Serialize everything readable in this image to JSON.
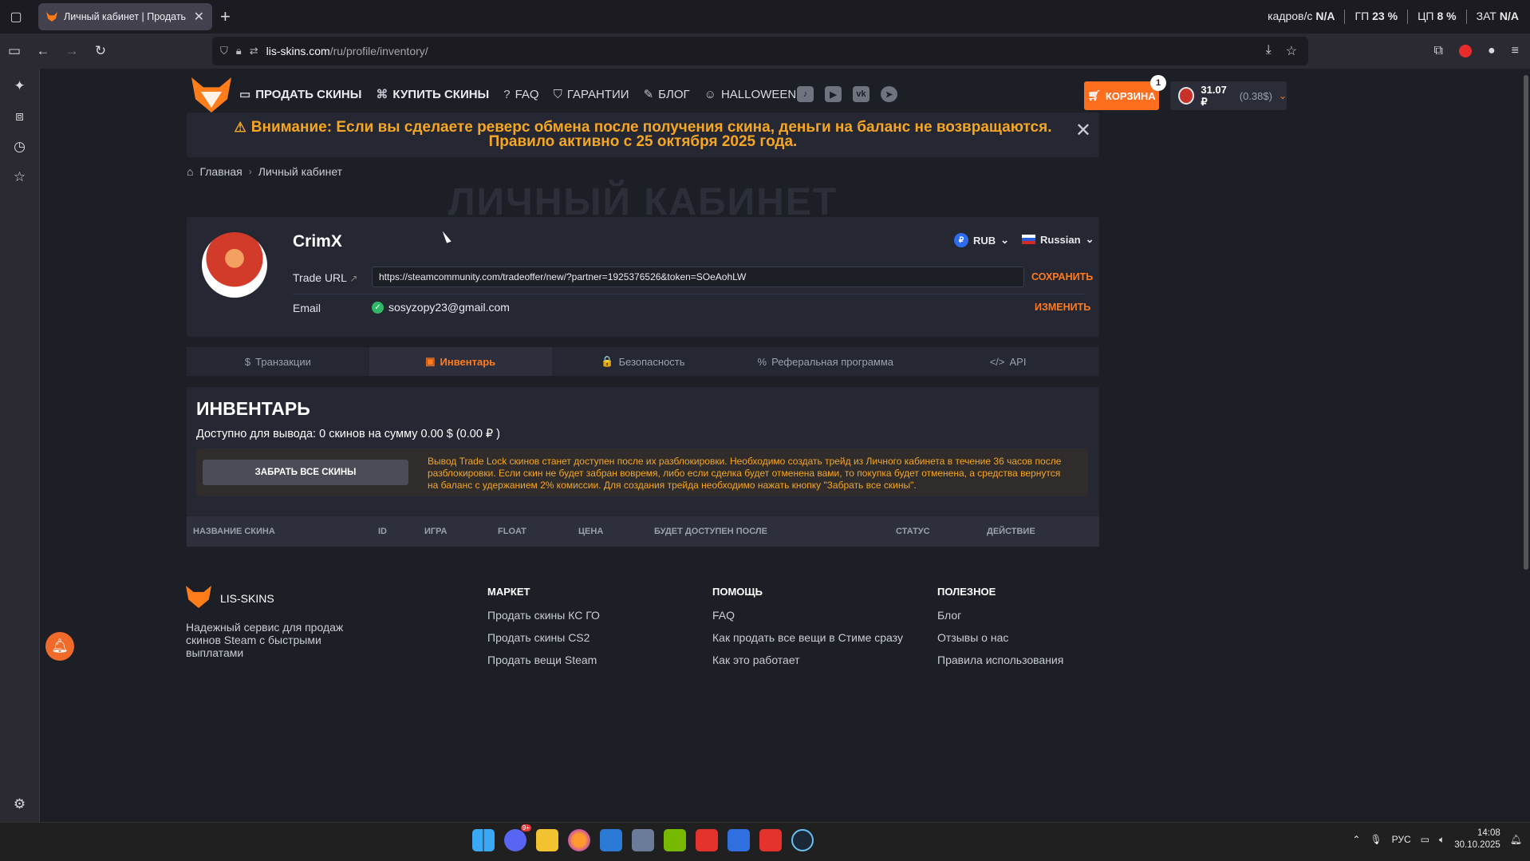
{
  "browser": {
    "tab_title": "Личный кабинет | Продать ск",
    "url_host": "lis-skins.com",
    "url_path": "/ru/profile/inventory/",
    "sysmon": [
      {
        "label": "кадров/с",
        "value": "N/A"
      },
      {
        "label": "ГП",
        "value": "23 %"
      },
      {
        "label": "ЦП",
        "value": "8 %"
      },
      {
        "label": "ЗАТ",
        "value": "N/A"
      }
    ]
  },
  "header": {
    "menu": [
      {
        "icon": "sell-icon",
        "label": "ПРОДАТЬ СКИНЫ"
      },
      {
        "icon": "buy-icon",
        "label": "КУПИТЬ СКИНЫ"
      },
      {
        "icon": "help-icon",
        "label": "FAQ"
      },
      {
        "icon": "shield-icon",
        "label": "ГАРАНТИИ"
      },
      {
        "icon": "edit-icon",
        "label": "БЛОГ"
      },
      {
        "icon": "pumpkin-icon",
        "label": "HALLOWEEN"
      }
    ],
    "socials": [
      "tiktok-icon",
      "youtube-icon",
      "vk-icon",
      "telegram-icon"
    ],
    "cart_label": "КОРЗИНА",
    "cart_count": "1",
    "balance_rub": "31.07 ₽",
    "balance_usd": "(0.38$)"
  },
  "banner": {
    "line1": "Внимание: Если вы сделаете реверс обмена после получения скина, деньги на баланс не возвращаются.",
    "line2": "Правило активно с 25 октября 2025 года."
  },
  "breadcrumb": {
    "home": "Главная",
    "current": "Личный кабинет"
  },
  "page_title": "ЛИЧНЫЙ КАБИНЕТ",
  "profile": {
    "username": "CrimX",
    "currency": "RUB",
    "currency_symbol": "₽",
    "language": "Russian",
    "trade_url_label": "Trade URL",
    "trade_url_value": "https://steamcommunity.com/tradeoffer/new/?partner=1925376526&token=SOeAohLW",
    "save_label": "СОХРАНИТЬ",
    "email_label": "Email",
    "email_value": "sosyzopy23@gmail.com",
    "change_label": "ИЗМЕНИТЬ"
  },
  "tabs": [
    {
      "icon": "$",
      "label": "Транзакции"
    },
    {
      "icon": "▣",
      "label": "Инвентарь"
    },
    {
      "icon": "🔒",
      "label": "Безопасность"
    },
    {
      "icon": "%",
      "label": "Реферальная программа"
    },
    {
      "icon": "</>",
      "label": "API"
    }
  ],
  "inventory": {
    "title": "ИНВЕНТАРЬ",
    "available": "Доступно для вывода: 0 скинов на сумму 0.00 $ (0.00 ₽ )",
    "claim_button": "ЗАБРАТЬ ВСЕ СКИНЫ",
    "notice": "Вывод Trade Lock скинов станет доступен после их разблокировки. Необходимо создать трейд из Личного кабинета в течение 36 часов после разблокировки. Если скин не будет забран вовремя, либо если сделка будет отменена вами, то покупка будет отменена, а средства вернутся на баланс с удержанием 2% комиссии. Для создания трейда необходимо нажать кнопку \"Забрать все скины\".",
    "columns": [
      "НАЗВАНИЕ СКИНА",
      "ID",
      "ИГРА",
      "FLOAT",
      "ЦЕНА",
      "БУДЕТ ДОСТУПЕН ПОСЛЕ",
      "СТАТУС",
      "ДЕЙСТВИЕ"
    ]
  },
  "footer": {
    "brand": "LIS-SKINS",
    "description": "Надежный сервис для продаж скинов Steam с быстрыми выплатами",
    "columns": [
      {
        "title": "МАРКЕТ",
        "links": [
          "Продать скины КС ГО",
          "Продать скины CS2",
          "Продать вещи Steam"
        ]
      },
      {
        "title": "ПОМОЩЬ",
        "links": [
          "FAQ",
          "Как продать все вещи в Стиме сразу",
          "Как это работает"
        ]
      },
      {
        "title": "ПОЛЕЗНОЕ",
        "links": [
          "Блог",
          "Отзывы о нас",
          "Правила использования"
        ]
      }
    ]
  },
  "taskbar": {
    "lang": "РУС",
    "time": "14:08",
    "date": "30.10.2025",
    "discord_badge": "9+"
  }
}
